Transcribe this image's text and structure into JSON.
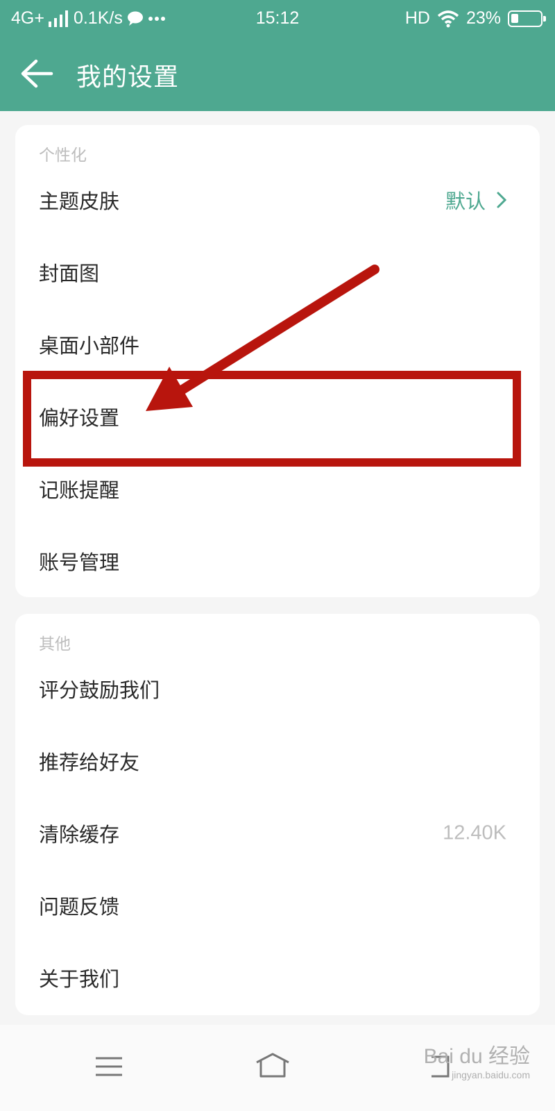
{
  "status_bar": {
    "network": "4G+",
    "speed": "0.1K/s",
    "time": "15:12",
    "hd": "HD",
    "battery": "23%",
    "battery_level": 0.23
  },
  "header": {
    "title": "我的设置"
  },
  "section_personalization": {
    "label": "个性化",
    "items": [
      {
        "label": "主题皮肤",
        "value": "默认"
      },
      {
        "label": "封面图"
      },
      {
        "label": "桌面小部件"
      },
      {
        "label": "偏好设置"
      },
      {
        "label": "记账提醒"
      },
      {
        "label": "账号管理"
      }
    ]
  },
  "section_other": {
    "label": "其他",
    "items": [
      {
        "label": "评分鼓励我们"
      },
      {
        "label": "推荐给好友"
      },
      {
        "label": "清除缓存",
        "value": "12.40K"
      },
      {
        "label": "问题反馈"
      },
      {
        "label": "关于我们"
      }
    ]
  },
  "watermark": {
    "brand": "Bai du 经验",
    "url": "jingyan.baidu.com"
  },
  "colors": {
    "accent": "#4ea890",
    "annotation": "#b8150d"
  }
}
